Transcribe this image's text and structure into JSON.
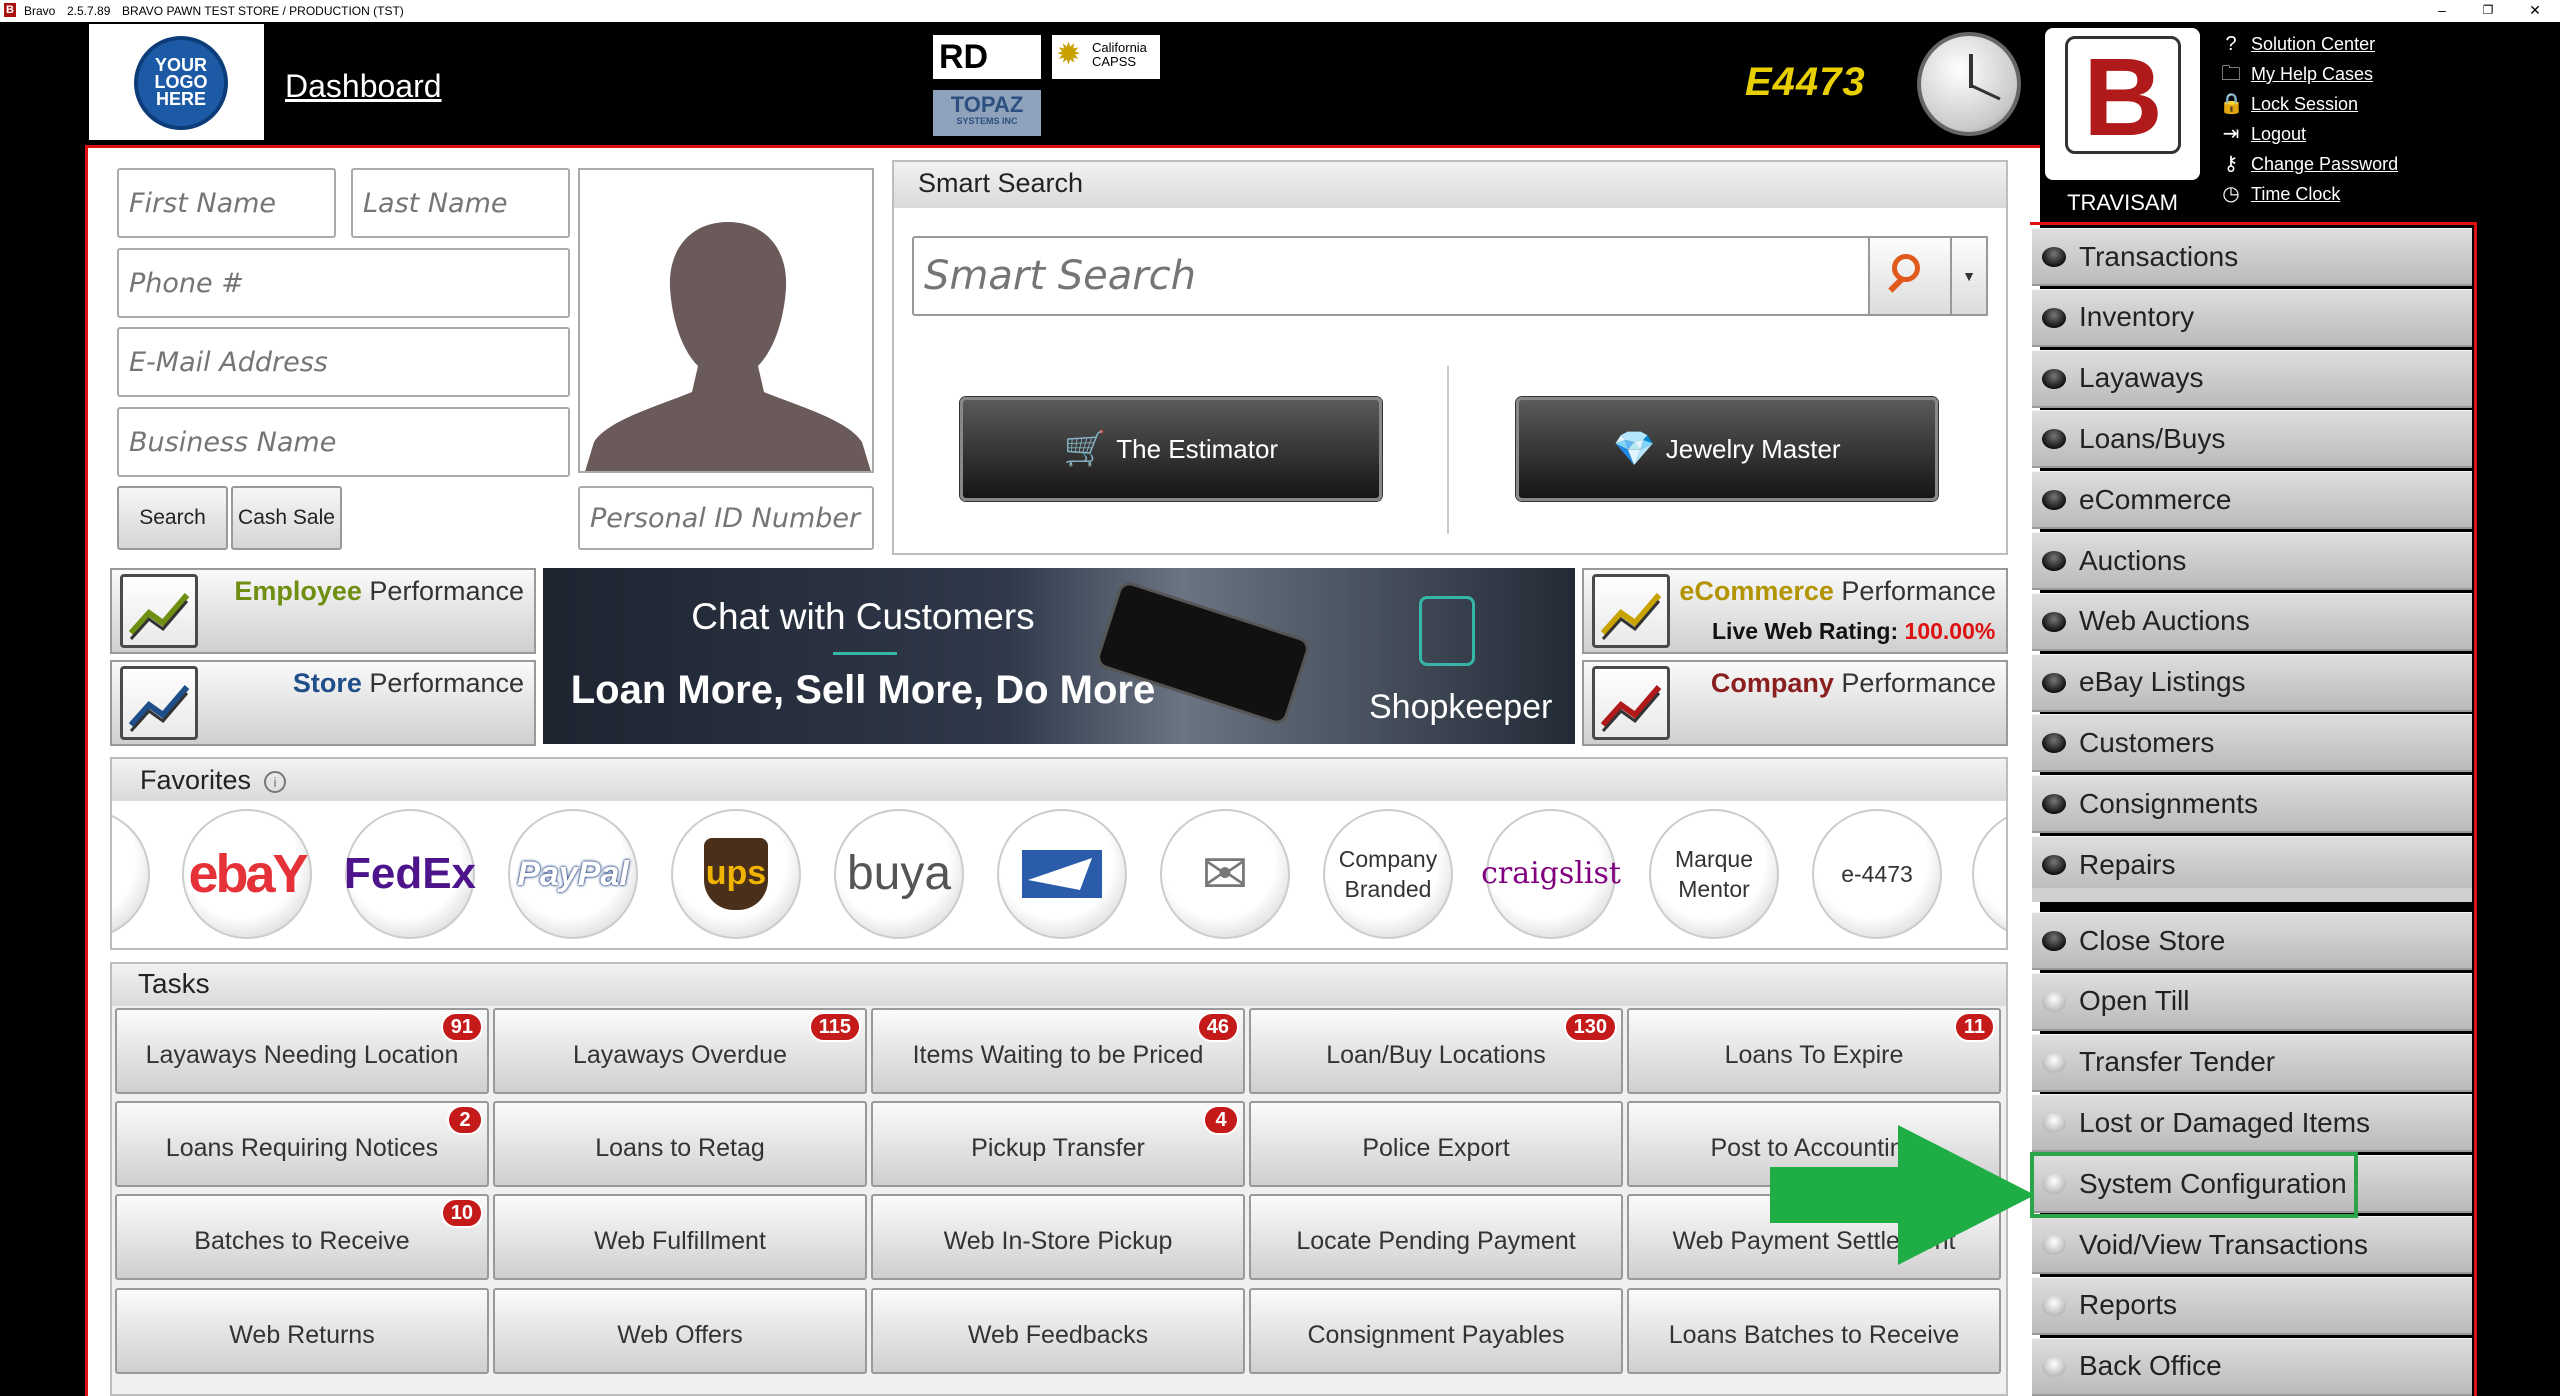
{
  "titlebar": {
    "app": "Bravo",
    "version": "2.5.7.89",
    "store": "BRAVO PAWN TEST STORE / PRODUCTION (TST)",
    "minimize": "–",
    "restore": "❐",
    "close": "✕"
  },
  "header": {
    "logo_text": "YOUR LOGO HERE",
    "dashboard": "Dashboard",
    "badge_rd": "RD",
    "badge_capss": "California CAPSS",
    "badge_topaz": "TOPAZ",
    "badge_topaz_sub": "SYSTEMS INC",
    "e4473": "E4473",
    "user_name": "TRAVISAM",
    "links": [
      {
        "label": "Solution Center",
        "icon": "question-circle-icon",
        "glyph": "?"
      },
      {
        "label": "My Help Cases",
        "icon": "folder-icon",
        "glyph": "🗀"
      },
      {
        "label": "Lock Session",
        "icon": "lock-icon",
        "glyph": "🔒"
      },
      {
        "label": "Logout",
        "icon": "logout-icon",
        "glyph": "⇥"
      },
      {
        "label": "Change Password",
        "icon": "key-icon",
        "glyph": "⚷"
      },
      {
        "label": "Time Clock",
        "icon": "clock-icon",
        "glyph": "◷"
      }
    ]
  },
  "customer": {
    "first_name_ph": "First Name",
    "last_name_ph": "Last Name",
    "phone_ph": "Phone #",
    "email_ph": "E-Mail Address",
    "business_ph": "Business Name",
    "personal_id_ph": "Personal ID Number",
    "search": "Search",
    "cash_sale": "Cash Sale"
  },
  "smart_search": {
    "title": "Smart Search",
    "placeholder": "Smart Search",
    "estimator": "The Estimator",
    "jewelry_master": "Jewelry Master"
  },
  "performance": {
    "employee_hl": "Employee",
    "store_hl": "Store",
    "ecommerce_hl": "eCommerce",
    "company_hl": "Company",
    "suffix": "Performance",
    "web_rating_label": "Live Web Rating:",
    "web_rating_value": "100.00%",
    "colors": {
      "employee": "#6f8f12",
      "store": "#1f4f8a",
      "ecommerce": "#b39300",
      "company": "#8a1f1f"
    }
  },
  "banner": {
    "line1": "Chat with Customers",
    "line2": "Loan More, Sell More, Do More",
    "brand": "Shopkeeper"
  },
  "favorites": {
    "title": "Favorites",
    "info": "i",
    "items": [
      {
        "name": "ebay",
        "text": "ebaY"
      },
      {
        "name": "fedex",
        "text": "FedEx"
      },
      {
        "name": "paypal",
        "text": "PayPal"
      },
      {
        "name": "ups",
        "text": "ups"
      },
      {
        "name": "buya",
        "text": "buya"
      },
      {
        "name": "usps",
        "text": ""
      },
      {
        "name": "email",
        "text": "✉"
      },
      {
        "name": "company-branded",
        "text": "Company Branded"
      },
      {
        "name": "craigslist",
        "text": "craigslist"
      },
      {
        "name": "marque-mentor",
        "text": "Marque Mentor"
      },
      {
        "name": "e4473",
        "text": "e-4473"
      }
    ]
  },
  "tasks": {
    "title": "Tasks",
    "items": [
      {
        "label": "Layaways Needing Location",
        "badge": "91"
      },
      {
        "label": "Layaways Overdue",
        "badge": "115"
      },
      {
        "label": "Items Waiting to be Priced",
        "badge": "46"
      },
      {
        "label": "Loan/Buy Locations",
        "badge": "130"
      },
      {
        "label": "Loans To Expire",
        "badge": "11"
      },
      {
        "label": "Loans Requiring Notices",
        "badge": "2"
      },
      {
        "label": "Loans to Retag",
        "badge": ""
      },
      {
        "label": "Pickup Transfer",
        "badge": "4"
      },
      {
        "label": "Police Export",
        "badge": ""
      },
      {
        "label": "Post to Accounting",
        "badge": ""
      },
      {
        "label": "Batches to Receive",
        "badge": "10"
      },
      {
        "label": "Web Fulfillment",
        "badge": ""
      },
      {
        "label": "Web In-Store Pickup",
        "badge": ""
      },
      {
        "label": "Locate Pending Payment",
        "badge": ""
      },
      {
        "label": "Web Payment Settlement",
        "badge": ""
      },
      {
        "label": "Web Returns",
        "badge": ""
      },
      {
        "label": "Web Offers",
        "badge": ""
      },
      {
        "label": "Web Feedbacks",
        "badge": ""
      },
      {
        "label": "Consignment Payables",
        "badge": ""
      },
      {
        "label": "Loans Batches to Receive",
        "badge": ""
      }
    ]
  },
  "sidebar": {
    "modules": [
      "Transactions",
      "Inventory",
      "Layaways",
      "Loans/Buys",
      "eCommerce",
      "Auctions",
      "Web Auctions",
      "eBay Listings",
      "Customers",
      "Consignments",
      "Repairs"
    ],
    "actions": [
      "Close Store",
      "Open Till",
      "Transfer Tender",
      "Lost or Damaged Items",
      "System Configuration",
      "Void/View Transactions",
      "Reports",
      "Back Office"
    ],
    "highlighted": "System Configuration",
    "highlight_color": "#2ca44a"
  }
}
